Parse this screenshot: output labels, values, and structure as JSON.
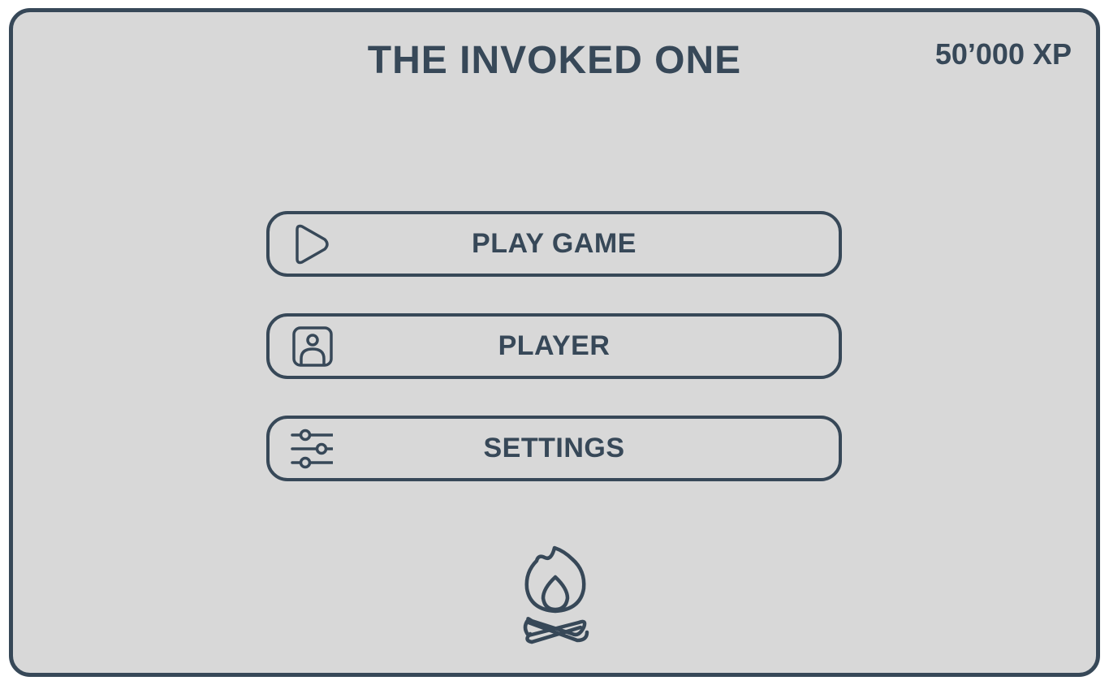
{
  "header": {
    "title": "THE INVOKED ONE",
    "xp": "50’000 XP"
  },
  "menu": {
    "items": [
      {
        "label": "PLAY GAME",
        "icon": "play-icon"
      },
      {
        "label": "PLAYER",
        "icon": "player-profile-icon"
      },
      {
        "label": "SETTINGS",
        "icon": "sliders-icon"
      }
    ]
  },
  "decoration": {
    "icon": "campfire-icon"
  },
  "colors": {
    "background": "#d8d8d8",
    "ink": "#374858"
  }
}
